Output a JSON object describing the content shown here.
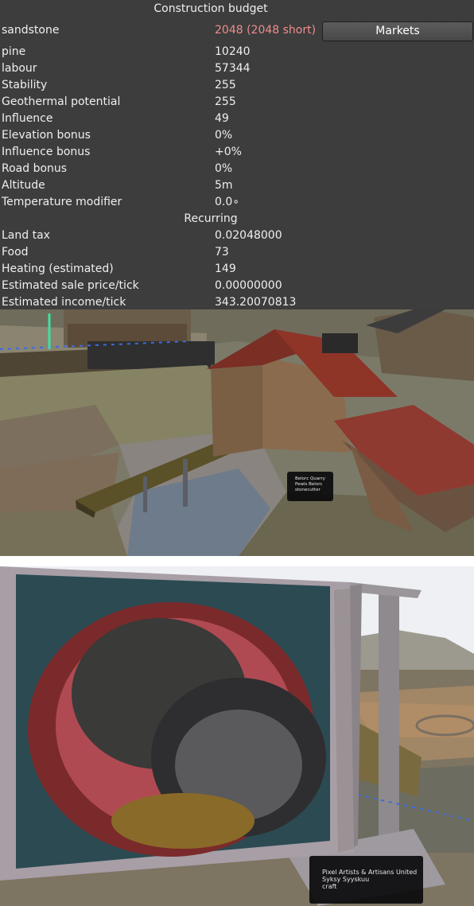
{
  "window_title": "Construction budget",
  "rows": [
    {
      "label": "sandstone",
      "value": "2048 (2048 short)",
      "status": "short"
    },
    {
      "label": "pine",
      "value": "10240"
    },
    {
      "label": "labour",
      "value": "57344"
    },
    {
      "label": "Stability",
      "value": "255"
    },
    {
      "label": "Geothermal potential",
      "value": "255"
    },
    {
      "label": "Influence",
      "value": "49"
    },
    {
      "label": "Elevation bonus",
      "value": "0%"
    },
    {
      "label": "Influence bonus",
      "value": "+0%"
    },
    {
      "label": "Road bonus",
      "value": "0%"
    },
    {
      "label": "Altitude",
      "value": "5m"
    },
    {
      "label": "Temperature modifier",
      "value": "0.0∘"
    }
  ],
  "recurring_header": "Recurring",
  "recurring_rows": [
    {
      "label": "Land tax",
      "value": "0.02048000"
    },
    {
      "label": "Food",
      "value": "73"
    },
    {
      "label": "Heating (estimated)",
      "value": "149"
    },
    {
      "label": "Estimated sale price/tick",
      "value": "0.00000000"
    },
    {
      "label": "Estimated income/tick",
      "value": "343.20070813"
    }
  ],
  "markets_button": "Markets",
  "colors": {
    "shortage": "#f08c8c",
    "panel_bg": "#3d3d3d"
  },
  "scene1": {
    "tooltip": {
      "line1": "Belorc Quarry",
      "line2": "Pewls Belorc",
      "line3": "stonecutter"
    }
  },
  "scene2": {
    "tooltip": {
      "line1": "Pixel Artists & Artisans United",
      "line2": "Syksy Syyskuu",
      "line3": "craft"
    }
  }
}
